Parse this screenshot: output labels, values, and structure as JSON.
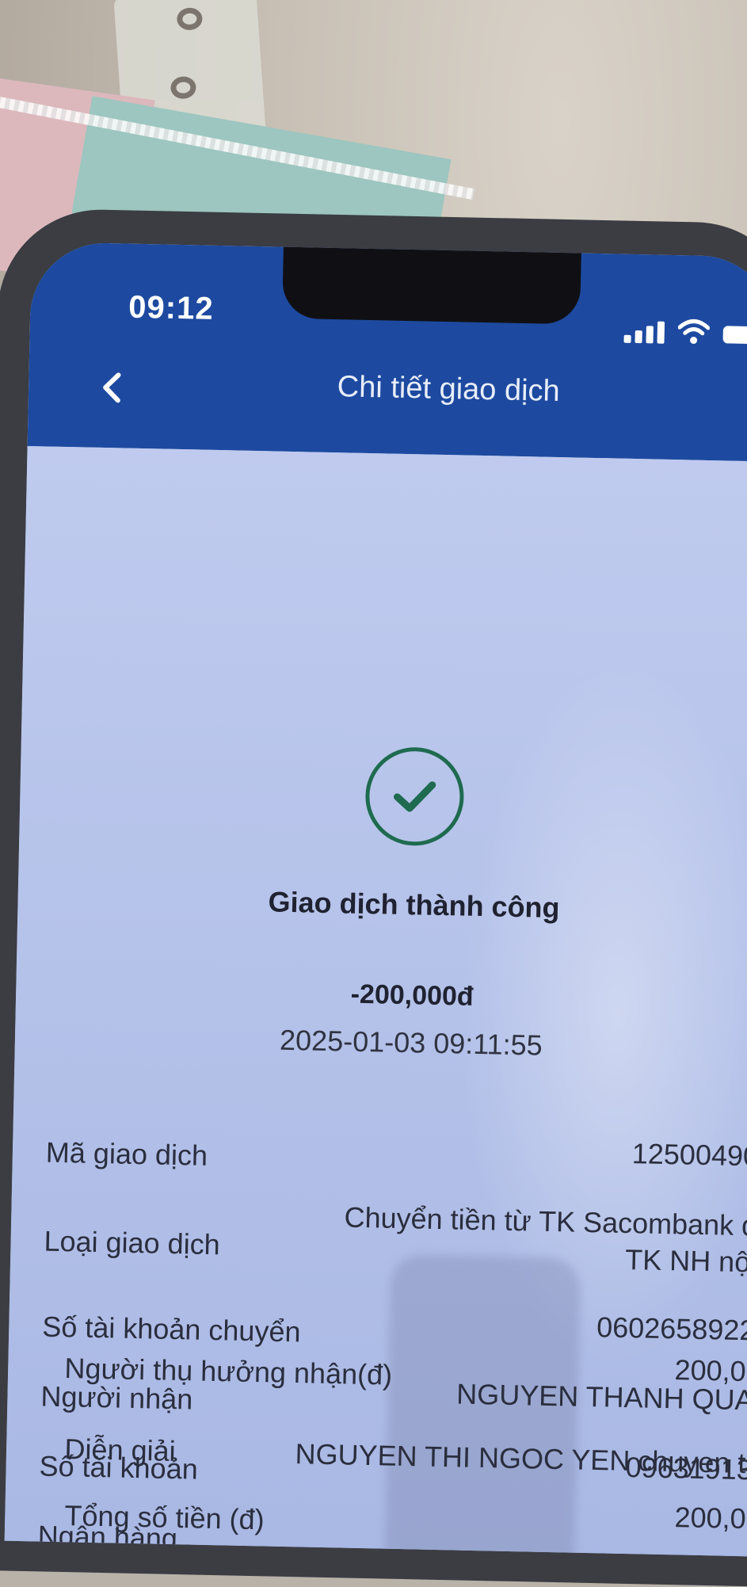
{
  "status_bar": {
    "time": "09:12"
  },
  "header": {
    "title": "Chi tiết giao dịch",
    "back_icon": "chevron-left-icon"
  },
  "result": {
    "status_icon": "checkmark-circle-icon",
    "status_text": "Giao dịch thành công",
    "amount": "-200,000đ",
    "datetime": "2025-01-03 09:11:55"
  },
  "details": [
    {
      "label": "Mã giao dịch",
      "value": "12500490"
    },
    {
      "label": "Loại giao dịch",
      "value_line1": "Chuyển tiền từ TK Sacombank đ",
      "value_line2": "TK NH nội"
    },
    {
      "label": "Số tài khoản chuyển",
      "value": "0602658922"
    },
    {
      "label": "Người nhận",
      "value": "NGUYEN THANH QUA"
    },
    {
      "label": "Số tài khoản",
      "value": "09631913"
    },
    {
      "label": "Ngân hàng",
      "value": ""
    },
    {
      "label": "Người thụ hưởng nhận(đ)",
      "value": "200,0"
    },
    {
      "label": "Diễn giải",
      "value": "NGUYEN THI NGOC YEN chuyen t"
    },
    {
      "label": "Tổng số tiền (đ)",
      "value": "200,0"
    }
  ],
  "colors": {
    "header_bg": "#1d4aa0",
    "content_bg": "#b9c6ea",
    "success": "#1e6b4f",
    "text": "#2a2e3d"
  }
}
